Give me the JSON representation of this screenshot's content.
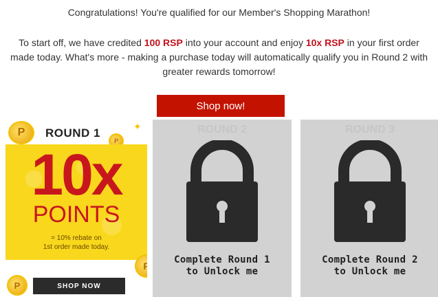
{
  "intro": {
    "headline": "Congratulations! You're qualified for our Member's Shopping Marathon!",
    "body_part1": "To start off, we have credited ",
    "credit_amount": "100 RSP",
    "body_part2": " into your account and enjoy ",
    "multiplier": "10x RSP",
    "body_part3": " in your first order made today. What's more - making a purchase today will automatically qualify you in Round 2 with greater rewards tomorrow!"
  },
  "shop_now_label": "Shop now!",
  "round1": {
    "title": "ROUND 1",
    "big_text": "10x",
    "points_text": "POINTS",
    "sub_line1": "= 10% rebate on",
    "sub_line2": "1st order made today.",
    "shop_label": "SHOP NOW",
    "coin_letter": "P"
  },
  "round2": {
    "ghost_title": "ROUND 2",
    "line1": "Complete Round 1",
    "line2": "to Unlock me"
  },
  "round3": {
    "ghost_title": "ROUND 3",
    "line1": "Complete Round 2",
    "line2": "to Unlock me"
  },
  "colors": {
    "accent_red": "#c41200",
    "highlight_red": "#c0121c",
    "yellow": "#f9d71c",
    "locked_gray": "#d2d2d2"
  }
}
